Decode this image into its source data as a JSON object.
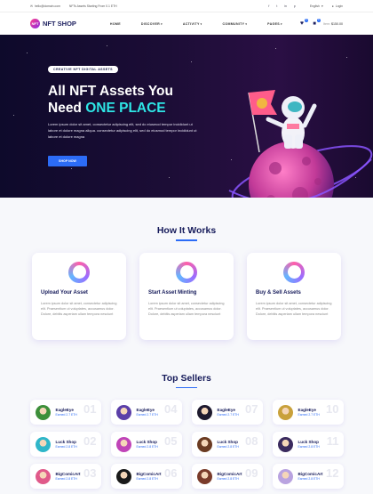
{
  "topbar": {
    "email": "hello@domain.com",
    "promo": "NFTs Assets Starting From 0.1 ETH",
    "language": "English",
    "login": "Login"
  },
  "nav": {
    "logo_mark": "NFT",
    "brand": "NFT SHOP",
    "items": [
      "HOME",
      "DISCOVER",
      "ACTIVITY",
      "COMMUNITY",
      "PAGES"
    ],
    "wishlist_count": "0",
    "cart_count": "0",
    "balance_label": "Item:",
    "balance": "$150.00"
  },
  "hero": {
    "tagline": "CREATIVE NFT DIGITAL ASSETS",
    "title_line1": "All NFT Assets You",
    "title_line2_prefix": "Need",
    "title_line2_accent": "ONE PLACE",
    "description": "Lorem ipsum dolor sit amet, consectetur adipiscing elit, sed do eiusmod tempor incididunt ut labore et dolore magna aliqua. consectetur adipiscing elit, sed do eiusmod tempor incididunt ut labore et dolore magna",
    "button": "SHOP NOW",
    "accent_color": "#2ee6e6"
  },
  "how": {
    "title": "How It Works",
    "cards": [
      {
        "title": "Upload Your Asset",
        "text": "Lorem ipsum dolor sit amet, consectetur adipiscing elit. Praesentium ut voluptates, accusamus dolor. Dolore, debitis asperiam ullam tempora nesciunt"
      },
      {
        "title": "Start Asset Minting",
        "text": "Lorem ipsum dolor sit amet, consectetur adipiscing elit. Praesentium ut voluptates, accusamus dolor. Dolore, debitis asperiam ullam tempora nesciunt"
      },
      {
        "title": "Buy & Sell Assets",
        "text": "Lorem ipsum dolor sit amet, consectetur adipiscing elit. Praesentium ut voluptates, accusamus dolor. Dolore, debitis asperiam ullam tempora nesciunt"
      }
    ]
  },
  "sellers": {
    "title": "Top Sellers",
    "items": [
      {
        "name": "EagleEye",
        "earned": "Earned 2.7 ETH",
        "rank": "01",
        "avatar": "#3d8f3a"
      },
      {
        "name": "EagleEye",
        "earned": "Earned 2.7 ETH",
        "rank": "04",
        "avatar": "#5b3fa8"
      },
      {
        "name": "EagleEye",
        "earned": "Earned 2.7 ETH",
        "rank": "07",
        "avatar": "#1e1a2e"
      },
      {
        "name": "EagleEye",
        "earned": "Earned 2.7 ETH",
        "rank": "10",
        "avatar": "#c9a13b"
      },
      {
        "name": "Luck Shop",
        "earned": "Earned 2.8 ETH",
        "rank": "02",
        "avatar": "#2fb6c9"
      },
      {
        "name": "Luck Shop",
        "earned": "Earned 2.8 ETH",
        "rank": "05",
        "avatar": "#c044b8"
      },
      {
        "name": "Luck Shop",
        "earned": "Earned 2.8 ETH",
        "rank": "08",
        "avatar": "#6b3b22"
      },
      {
        "name": "Luck Shop",
        "earned": "Earned 2.8 ETH",
        "rank": "11",
        "avatar": "#3a2a5e"
      },
      {
        "name": "BigComicArt",
        "earned": "Earned 2.8 ETH",
        "rank": "03",
        "avatar": "#e05a8a"
      },
      {
        "name": "BigComicArt",
        "earned": "Earned 2.8 ETH",
        "rank": "06",
        "avatar": "#1a1a1a"
      },
      {
        "name": "BigComicArt",
        "earned": "Earned 2.8 ETH",
        "rank": "09",
        "avatar": "#7a3b2a"
      },
      {
        "name": "BigComicArt",
        "earned": "Earned 2.8 ETH",
        "rank": "12",
        "avatar": "#b9a3e0"
      }
    ]
  }
}
